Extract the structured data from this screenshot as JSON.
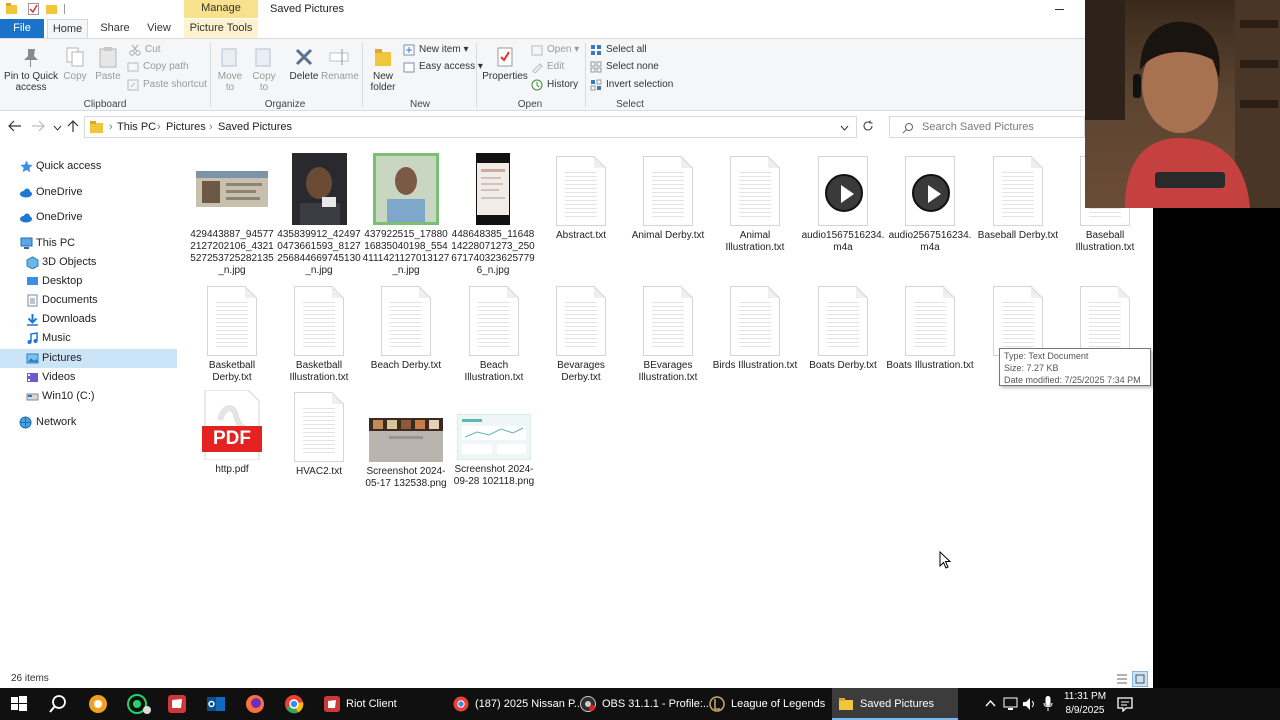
{
  "window": {
    "title": "Saved Pictures",
    "contextual_tab": "Manage"
  },
  "ribbon_tabs": {
    "file": "File",
    "home": "Home",
    "share": "Share",
    "view": "View",
    "picture_tools": "Picture Tools"
  },
  "ribbon": {
    "clipboard": {
      "label": "Clipboard",
      "pin": "Pin to Quick access",
      "copy": "Copy",
      "paste": "Paste",
      "cut": "Cut",
      "copy_path": "Copy path",
      "paste_shortcut": "Paste shortcut"
    },
    "organize": {
      "label": "Organize",
      "move_to": "Move to",
      "copy_to": "Copy to",
      "delete": "Delete",
      "rename": "Rename"
    },
    "new": {
      "label": "New",
      "new_folder": "New folder",
      "new_item": "New item",
      "easy_access": "Easy access"
    },
    "open": {
      "label": "Open",
      "properties": "Properties",
      "open": "Open",
      "edit": "Edit",
      "history": "History"
    },
    "select": {
      "label": "Select",
      "select_all": "Select all",
      "select_none": "Select none",
      "invert_selection": "Invert selection"
    }
  },
  "address": {
    "crumbs": [
      "This PC",
      "Pictures",
      "Saved Pictures"
    ],
    "search_placeholder": "Search Saved Pictures"
  },
  "nav": {
    "quick_access": "Quick access",
    "onedrive1": "OneDrive",
    "onedrive2": "OneDrive",
    "this_pc": "This PC",
    "objects3d": "3D Objects",
    "desktop": "Desktop",
    "documents": "Documents",
    "downloads": "Downloads",
    "music": "Music",
    "pictures": "Pictures",
    "videos": "Videos",
    "win10": "Win10 (C:)",
    "network": "Network"
  },
  "files": {
    "f1": "429443887_945772127202106_4321527253725282135_n.jpg",
    "f2": "435839912_424970473661593_8127256844669745130_n.jpg",
    "f3": "437922515_1788016835040198_5544111421127013127_n.jpg",
    "f4": "448648385_1164814228071273_2506717403236257796_n.jpg",
    "f5": "Abstract.txt",
    "f6": "Animal Derby.txt",
    "f7": "Animal Illustration.txt",
    "f8": "audio1567516234.m4a",
    "f9": "audio2567516234.m4a",
    "f10": "Baseball Derby.txt",
    "f11": "Baseball Illustration.txt",
    "f12": "Basketball Derby.txt",
    "f13": "Basketball Illustration.txt",
    "f14": "Beach Derby.txt",
    "f15": "Beach Illustration.txt",
    "f16": "Bevarages Derby.txt",
    "f17": "BEvarages Illustration.txt",
    "f18": "Birds Illustration.txt",
    "f19": "Boats Derby.txt",
    "f20": "Boats Illustration.txt",
    "f23": "http.pdf",
    "f24": "HVAC2.txt",
    "f25": "Screenshot 2024-05-17 132538.png",
    "f26": "Screenshot 2024-09-28 102118.png"
  },
  "tooltip": {
    "type": "Type: Text Document",
    "size": "Size: 7.27 KB",
    "modified": "Date modified: 7/25/2025 7:34 PM"
  },
  "status": {
    "count": "26 items"
  },
  "pdf_badge": "PDF",
  "taskbar": {
    "riot": "Riot Client",
    "chrome": "(187) 2025 Nissan P...",
    "obs": "OBS 31.1.1 - Profile:...",
    "league": "League of Legends",
    "explorer": "Saved Pictures",
    "time": "11:31 PM",
    "date": "8/9/2025"
  },
  "colors": {
    "accent": "#1a73c8",
    "manage": "#f8e18c",
    "selection": "#cce4f7",
    "taskbar": "#101010"
  }
}
